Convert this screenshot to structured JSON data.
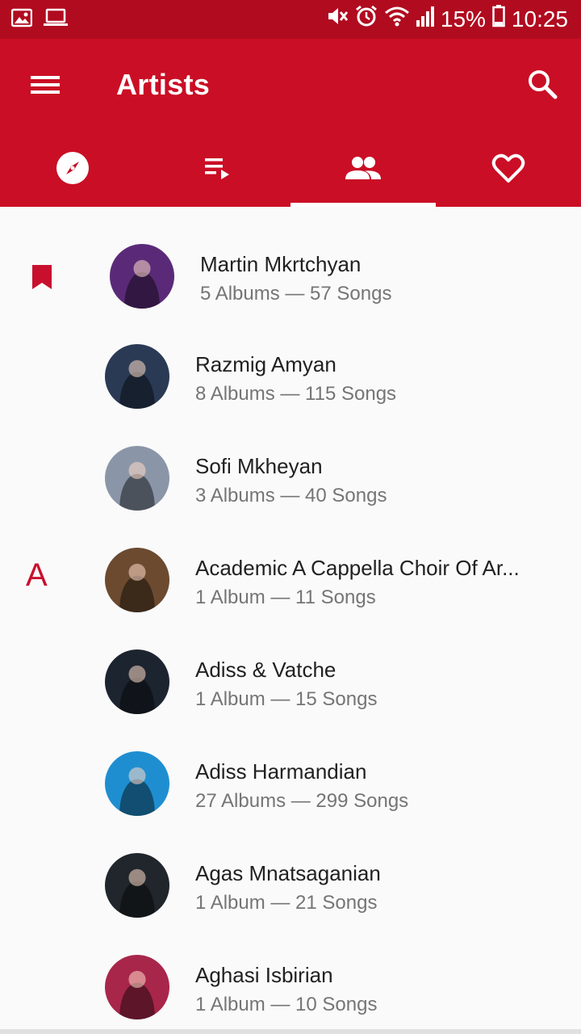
{
  "status_bar": {
    "battery": "15%",
    "time": "10:25"
  },
  "app_bar": {
    "title": "Artists"
  },
  "tabs": [
    {
      "icon": "compass-icon",
      "selected": false
    },
    {
      "icon": "playlist-icon",
      "selected": false
    },
    {
      "icon": "people-icon",
      "selected": true
    },
    {
      "icon": "heart-icon",
      "selected": false
    }
  ],
  "section_letter": "A",
  "artists": [
    {
      "name": "Martin Mkrtchyan",
      "meta": "5 Albums — 57 Songs",
      "avatar_color": "#5a2a78"
    },
    {
      "name": "Razmig Amyan",
      "meta": "8 Albums — 115 Songs",
      "avatar_color": "#2a3a55"
    },
    {
      "name": "Sofi Mkheyan",
      "meta": "3 Albums — 40 Songs",
      "avatar_color": "#8a96a8"
    },
    {
      "name": "Academic A Cappella Choir Of Ar...",
      "meta": "1 Album — 11 Songs",
      "avatar_color": "#6b4a30"
    },
    {
      "name": "Adiss & Vatche",
      "meta": "1 Album — 15 Songs",
      "avatar_color": "#1c2430"
    },
    {
      "name": "Adiss Harmandian",
      "meta": "27 Albums — 299 Songs",
      "avatar_color": "#1f8ed0"
    },
    {
      "name": "Agas Mnatsaganian",
      "meta": "1 Album — 21 Songs",
      "avatar_color": "#20262c"
    },
    {
      "name": "Aghasi Isbirian",
      "meta": "1 Album — 10 Songs",
      "avatar_color": "#a8264a"
    }
  ],
  "colors": {
    "status_bar": "#b10b1f",
    "app_bar": "#ca0e25",
    "accent": "#c8102e"
  }
}
